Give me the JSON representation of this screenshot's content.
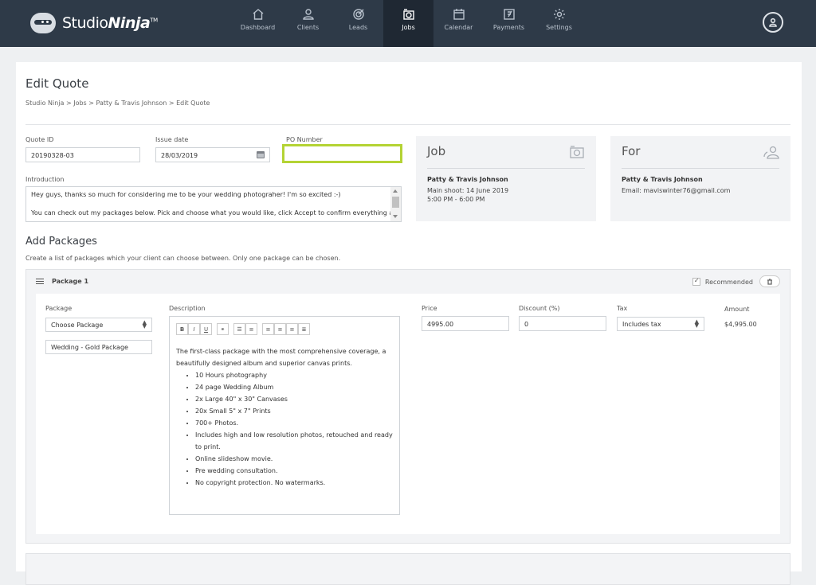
{
  "app": {
    "brand": "Studio",
    "brand_bold": "Ninja",
    "brand_tm": "TM"
  },
  "nav": [
    {
      "label": "Dashboard",
      "icon": "home-icon"
    },
    {
      "label": "Clients",
      "icon": "users-icon"
    },
    {
      "label": "Leads",
      "icon": "target-icon"
    },
    {
      "label": "Jobs",
      "icon": "camera-icon",
      "active": true
    },
    {
      "label": "Calendar",
      "icon": "calendar-icon"
    },
    {
      "label": "Payments",
      "icon": "invoice-icon"
    },
    {
      "label": "Settings",
      "icon": "gear-icon"
    }
  ],
  "page": {
    "title": "Edit Quote",
    "breadcrumb": "Studio Ninja  >  Jobs  >  Patty & Travis Johnson  >  Edit Quote"
  },
  "form": {
    "quote_id_label": "Quote ID",
    "quote_id_value": "20190328-03",
    "issue_date_label": "Issue date",
    "issue_date_value": "28/03/2019",
    "po_number_label": "PO Number",
    "po_number_value": "",
    "intro_label": "Introduction",
    "intro_line1": "Hey guys, thanks so much for considering me to be your wedding photograher! I'm so excited :-)",
    "intro_line2": "You can check out my packages below. Pick and choose what you would like, click Accept to confirm everything and"
  },
  "job_panel": {
    "title": "Job",
    "name": "Patty & Travis Johnson",
    "line1": "Main shoot: 14 June 2019",
    "line2": "5:00 PM - 6:00 PM"
  },
  "for_panel": {
    "title": "For",
    "name": "Patty & Travis Johnson",
    "email": "Email: maviswinter76@gmail.com"
  },
  "packages_section": {
    "title": "Add Packages",
    "subtitle": "Create a list of packages which your client can choose between. Only one package can be chosen."
  },
  "package1": {
    "title": "Package 1",
    "recommended_label": "Recommended",
    "package_label": "Package",
    "package_select": "Choose Package",
    "package_name": "Wedding - Gold Package",
    "description_label": "Description",
    "description_intro": "The first-class package with the most comprehensive coverage, a beautifully designed album and superior canvas prints.",
    "description_items": [
      "10 Hours photography",
      "24 page Wedding Album",
      "2x Large 40\" x 30\" Canvases",
      "20x Small 5\" x 7\" Prints",
      "700+ Photos.",
      "Includes high and low resolution photos, retouched and ready to print.",
      "Online slideshow movie.",
      "Pre wedding consultation.",
      "No copyright protection. No watermarks."
    ],
    "price_label": "Price",
    "price_value": "4995.00",
    "discount_label": "Discount (%)",
    "discount_value": "0",
    "tax_label": "Tax",
    "tax_value": "Includes tax",
    "amount_label": "Amount",
    "amount_value": "$4,995.00"
  },
  "toolbar": [
    "B",
    "I",
    "U",
    "link",
    "ul",
    "ol",
    "align-left",
    "align-center",
    "align-right",
    "justify"
  ],
  "colors": {
    "nav_bg": "#2e3a48",
    "highlight": "#b4d334"
  }
}
